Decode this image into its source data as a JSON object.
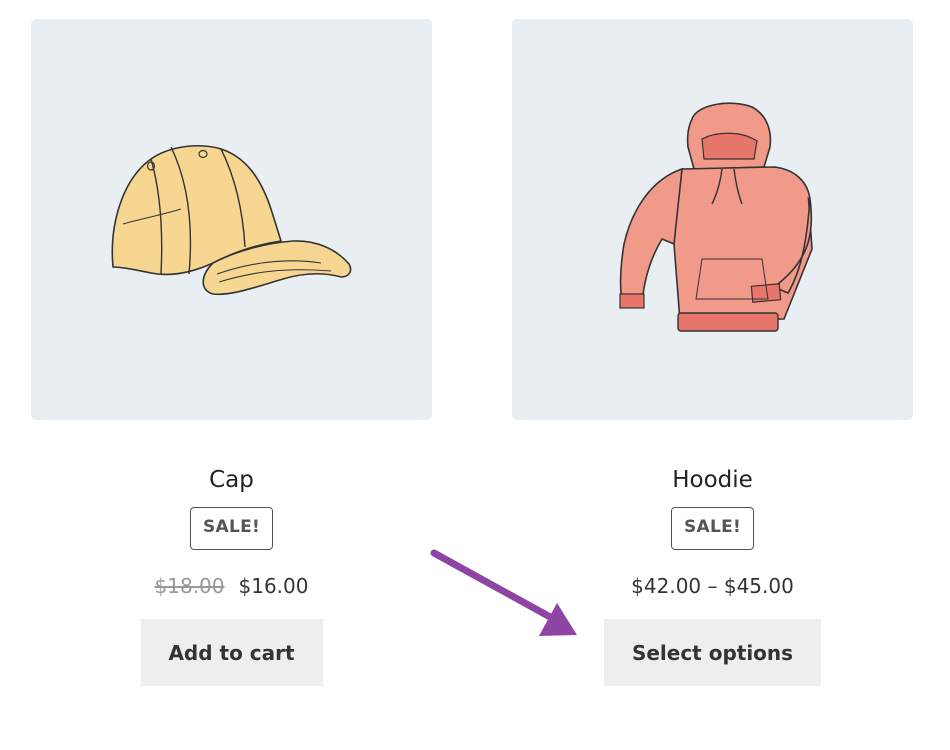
{
  "products": [
    {
      "name": "Cap",
      "badge": "SALE!",
      "price_old": "$18.00",
      "price_new": "$16.00",
      "button": "Add to cart",
      "icon": "cap-icon"
    },
    {
      "name": "Hoodie",
      "badge": "SALE!",
      "price_range": "$42.00 – $45.00",
      "button": "Select options",
      "icon": "hoodie-icon"
    }
  ],
  "colors": {
    "image_bg": "#e9eef3",
    "button_bg": "#eeeeee",
    "arrow": "#8e44a3",
    "cap": "#f7d692",
    "hoodie": "#f29a8a"
  }
}
